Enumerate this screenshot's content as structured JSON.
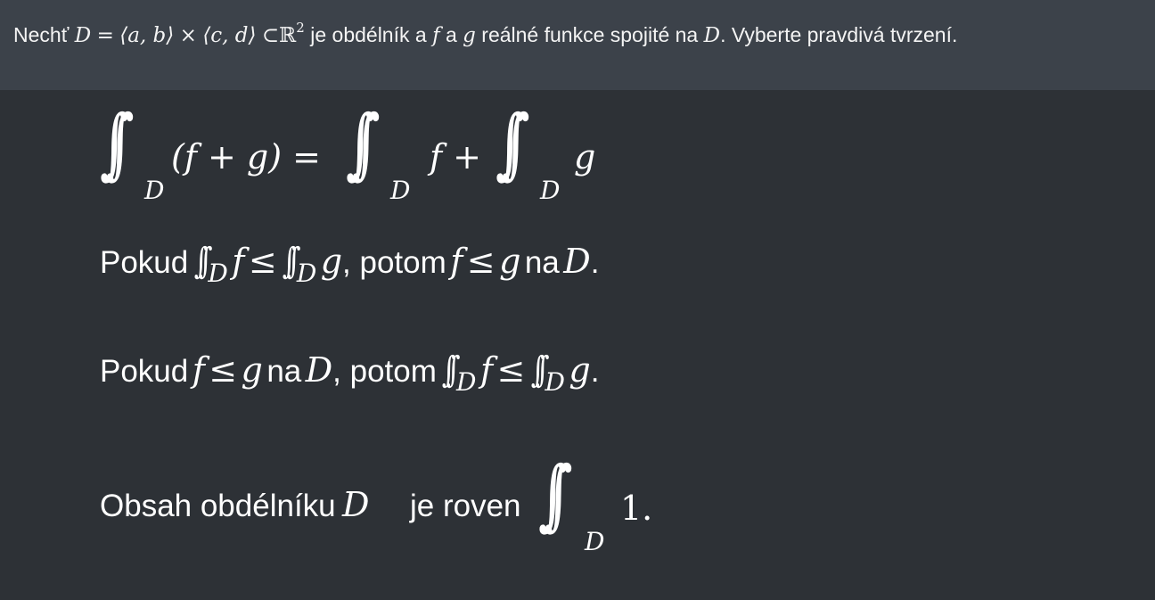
{
  "question": {
    "t1": "Nechť",
    "var_D": "D",
    "eq": "=",
    "interval_ab": "⟨a, b⟩",
    "times": "×",
    "interval_cd": "⟨c, d⟩",
    "subset": "⊂",
    "reals": "ℝ",
    "power": "2",
    "t2": "je obdélník a",
    "var_f": "f",
    "t3": "a",
    "var_g": "g",
    "t4": "reálné funkce spojité na",
    "var_D2": "D",
    "t5": ". Vyberte pravdivá tvrzení."
  },
  "options": [
    {
      "id": "linearity",
      "int_symbol": "∫∫",
      "sub": "D",
      "lhs_body": "(f + g) =",
      "mid_body": "f +",
      "rhs_body": "g"
    },
    {
      "id": "converse-monotonicity",
      "text_pokud": "Pokud",
      "int_symbol": "∫∫",
      "sub": "D",
      "f": "f",
      "le": "≤",
      "g": "g",
      "comma_potom": ", potom",
      "f2": "f",
      "le2": "≤",
      "g2": "g",
      "text_na": "na",
      "D": "D",
      "end": "."
    },
    {
      "id": "monotonicity",
      "text_pokud": "Pokud",
      "f": "f",
      "le": "≤",
      "g": "g",
      "text_na": "na",
      "D": "D",
      "comma_potom": ", potom",
      "int_symbol": "∫∫",
      "sub": "D",
      "f2": "f",
      "le2": "≤",
      "g2": "g",
      "end": "."
    },
    {
      "id": "area",
      "text": "Obsah obdélníku",
      "D": "D",
      "text2": "je roven",
      "int_symbol": "∫∫",
      "sub": "D",
      "body": "1."
    }
  ],
  "colors": {
    "header_bg": "#3c424a",
    "body_bg": "#2d3136",
    "text": "#ffffff"
  }
}
